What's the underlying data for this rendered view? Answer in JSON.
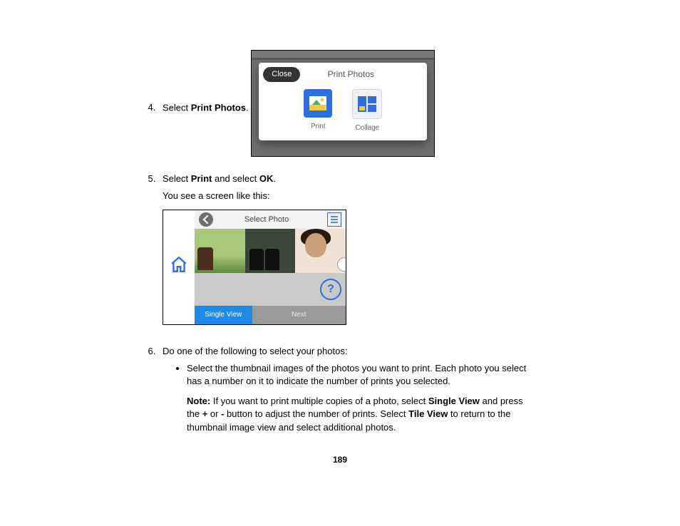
{
  "steps": {
    "s4": {
      "num": "4.",
      "pre": "Select ",
      "bold": "Print Photos",
      "post": "."
    },
    "s5": {
      "num": "5.",
      "pre": "Select ",
      "b1": "Print",
      "mid": " and select ",
      "b2": "OK",
      "post": ".",
      "line2": "You see a screen like this:"
    },
    "s6": {
      "num": "6.",
      "text": "Do one of the following to select your photos:"
    }
  },
  "shot1": {
    "close": "Close",
    "title": "Print Photos",
    "opt_print": "Print",
    "opt_collage": "Collage"
  },
  "shot2": {
    "title": "Select Photo",
    "single_view": "Single View",
    "next": "Next",
    "help": "?"
  },
  "bullet1": {
    "text": "Select the thumbnail images of the photos you want to print. Each photo you select has a number on it to indicate the number of prints you selected."
  },
  "note": {
    "label": "Note:",
    "p1": " If you want to print multiple copies of a photo, select ",
    "b1": "Single View",
    "p2": " and press the ",
    "b2": "+",
    "p3": " or ",
    "b3": "-",
    "p4": " button to adjust the number of prints. Select ",
    "b4": "Tile View",
    "p5": " to return to the thumbnail image view and select additional photos."
  },
  "page_number": "189"
}
